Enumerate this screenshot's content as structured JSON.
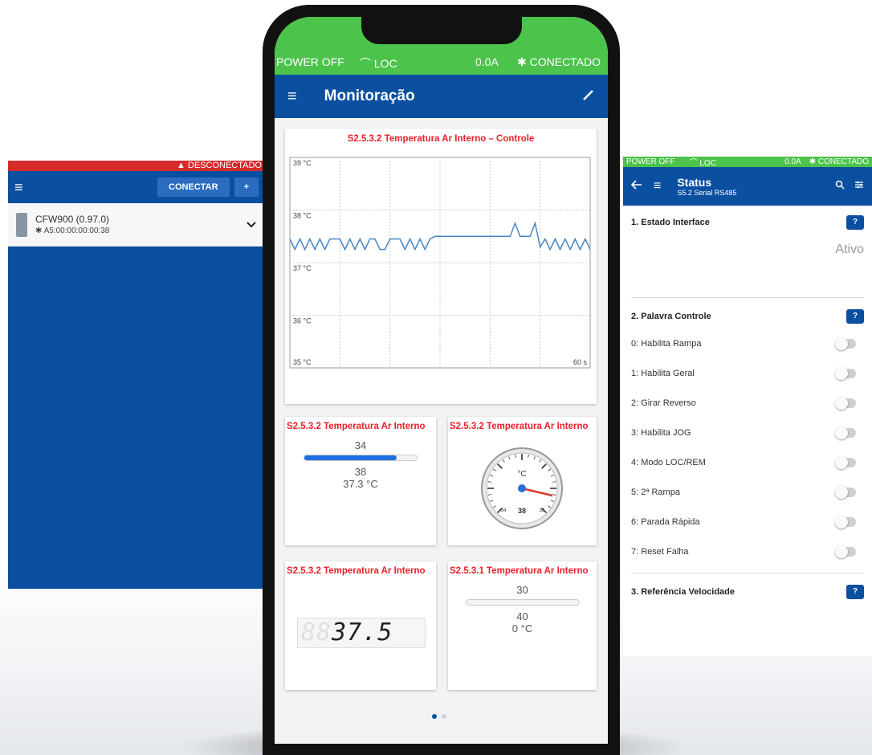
{
  "left_screen": {
    "status_text": "▲ DESCONECTADO",
    "connect_label": "CONECTAR",
    "add_label": "+",
    "device_name": "CFW900 (0.97.0)",
    "device_address": "✱ A5:00:00:00:00:38"
  },
  "phone": {
    "status": {
      "power": "POWER OFF",
      "loc": "⌒ LOC",
      "current": "0.0A",
      "connection": "✱ CONECTADO"
    },
    "title": "Monitoração",
    "chart_card": {
      "title": "S2.5.3.2 Temperatura Ar Interno – Controle",
      "y_ticks": [
        "39 °C",
        "38 °C",
        "37 °C",
        "36 °C",
        "35 °C"
      ],
      "x_label": "60 s"
    },
    "bar_card": {
      "title": "S2.5.3.2 Temperatura Ar Interno",
      "min": "34",
      "max": "38",
      "value": "37.3 °C",
      "fill_fraction": 0.82
    },
    "gauge_card": {
      "title": "S2.5.3.2 Temperatura Ar Interno",
      "unit": "°C",
      "readout": "38",
      "min_label": "34",
      "max_label": "38"
    },
    "digital_card": {
      "title": "S2.5.3.2 Temperatura Ar Interno",
      "dim_digits": "88",
      "value": "37.5"
    },
    "bar2_card": {
      "title": "S2.5.3.1 Temperatura Ar Interno",
      "min": "30",
      "max": "40",
      "value": "0 °C",
      "fill_fraction": 0
    }
  },
  "chart_data": {
    "type": "line",
    "title": "S2.5.3.2 Temperatura Ar Interno – Controle",
    "xlabel": "60 s",
    "ylabel": "",
    "ylim": [
      35,
      39
    ],
    "xlim": [
      0,
      60
    ],
    "grid": true,
    "series": [
      {
        "values": [
          37.45,
          37.25,
          37.45,
          37.25,
          37.45,
          37.25,
          37.45,
          37.25,
          37.45,
          37.45,
          37.45,
          37.25,
          37.45,
          37.25,
          37.45,
          37.25,
          37.45,
          37.45,
          37.25,
          37.25,
          37.45,
          37.45,
          37.45,
          37.25,
          37.45,
          37.25,
          37.45,
          37.25,
          37.45,
          37.5,
          37.5,
          37.5,
          37.5,
          37.5,
          37.5,
          37.5,
          37.5,
          37.5,
          37.5,
          37.5,
          37.5,
          37.5,
          37.5,
          37.5,
          37.5,
          37.75,
          37.5,
          37.5,
          37.5,
          37.75,
          37.3,
          37.45,
          37.25,
          37.45,
          37.25,
          37.45,
          37.25,
          37.45,
          37.25,
          37.45,
          37.25
        ]
      }
    ],
    "color": "#4a86c5"
  },
  "right_screen": {
    "status": {
      "power": "POWER OFF",
      "loc": "⌒ LOC",
      "current": "0.0A",
      "connection": "✱ CONECTADO"
    },
    "title": "Status",
    "subtitle": "S5.2 Serial RS485",
    "section1": {
      "heading": "1. Estado Interface",
      "value": "Ativo"
    },
    "section2": {
      "heading": "2. Palavra Controle",
      "items": [
        "0: Habilita Rampa",
        "1: Habilita Geral",
        "2: Girar Reverso",
        "3: Habilita JOG",
        "4: Modo LOC/REM",
        "5: 2ª Rampa",
        "6: Parada Rápida",
        "7: Reset Falha"
      ]
    },
    "section3": {
      "heading": "3. Referência Velocidade"
    },
    "help_label": "?"
  }
}
